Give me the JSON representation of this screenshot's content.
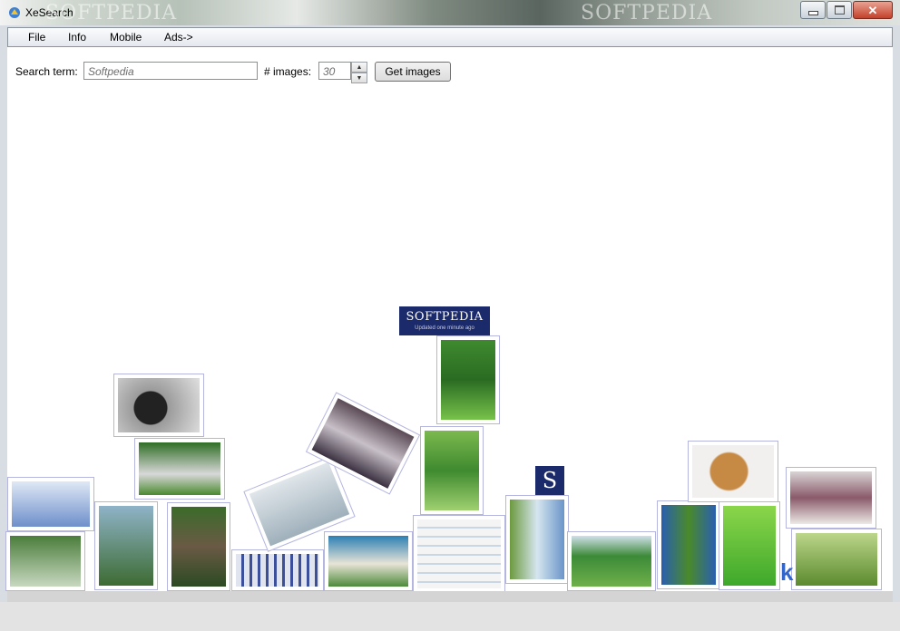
{
  "window": {
    "title": "XeSearch",
    "brand_watermark": "SOFTPEDIA"
  },
  "menu": {
    "file": "File",
    "info": "Info",
    "mobile": "Mobile",
    "ads": "Ads->"
  },
  "search": {
    "term_label": "Search term:",
    "term_value": "Softpedia",
    "count_label": "# images:",
    "count_value": "30",
    "button_label": "Get images"
  },
  "logos": {
    "softpedia_text": "SOFTPEDIA",
    "softpedia_sub": "Updated one minute ago",
    "s_box": "S",
    "k_letter": "k"
  },
  "colors": {
    "accent_blue": "#1b2a6b",
    "thumb_border": "#b4b6e0"
  }
}
